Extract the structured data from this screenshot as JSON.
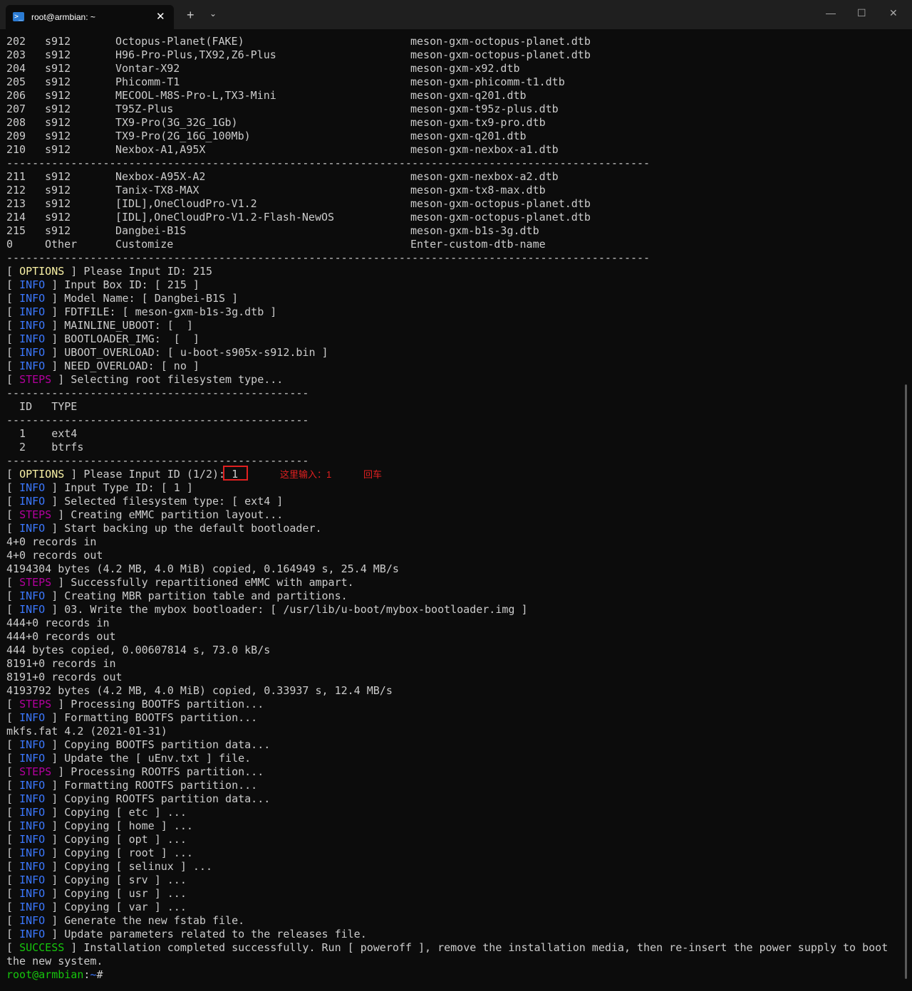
{
  "window": {
    "tab_title": "root@armbian: ~",
    "tab_icon": "powershell-icon",
    "tab_close": "✕",
    "new_tab": "+",
    "dropdown": "⌄",
    "minimize": "—",
    "maximize": "☐",
    "close": "✕"
  },
  "table_a": [
    [
      "202",
      "s912",
      "Octopus-Planet(FAKE)",
      "meson-gxm-octopus-planet.dtb"
    ],
    [
      "203",
      "s912",
      "H96-Pro-Plus,TX92,Z6-Plus",
      "meson-gxm-octopus-planet.dtb"
    ],
    [
      "204",
      "s912",
      "Vontar-X92",
      "meson-gxm-x92.dtb"
    ],
    [
      "205",
      "s912",
      "Phicomm-T1",
      "meson-gxm-phicomm-t1.dtb"
    ],
    [
      "206",
      "s912",
      "MECOOL-M8S-Pro-L,TX3-Mini",
      "meson-gxm-q201.dtb"
    ],
    [
      "207",
      "s912",
      "T95Z-Plus",
      "meson-gxm-t95z-plus.dtb"
    ],
    [
      "208",
      "s912",
      "TX9-Pro(3G_32G_1Gb)",
      "meson-gxm-tx9-pro.dtb"
    ],
    [
      "209",
      "s912",
      "TX9-Pro(2G_16G_100Mb)",
      "meson-gxm-q201.dtb"
    ],
    [
      "210",
      "s912",
      "Nexbox-A1,A95X",
      "meson-gxm-nexbox-a1.dtb"
    ]
  ],
  "table_b": [
    [
      "211",
      "s912",
      "Nexbox-A95X-A2",
      "meson-gxm-nexbox-a2.dtb"
    ],
    [
      "212",
      "s912",
      "Tanix-TX8-MAX",
      "meson-gxm-tx8-max.dtb"
    ],
    [
      "213",
      "s912",
      "[IDL],OneCloudPro-V1.2",
      "meson-gxm-octopus-planet.dtb"
    ],
    [
      "214",
      "s912",
      "[IDL],OneCloudPro-V1.2-Flash-NewOS",
      "meson-gxm-octopus-planet.dtb"
    ],
    [
      "215",
      "s912",
      "Dangbei-B1S",
      "meson-gxm-b1s-3g.dtb"
    ],
    [
      "0",
      "Other",
      "Customize",
      "Enter-custom-dtb-name"
    ]
  ],
  "long_separator": "----------------------------------------------------------------------------------------------------",
  "short_separator": "-----------------------------------------------",
  "log_a": [
    {
      "tag": "OPTIONS",
      "text": " ] Please Input ID: 215"
    },
    {
      "tag": "INFO",
      "text": " ] Input Box ID: [ 215 ]"
    },
    {
      "tag": "INFO",
      "text": " ] Model Name: [ Dangbei-B1S ]"
    },
    {
      "tag": "INFO",
      "text": " ] FDTFILE: [ meson-gxm-b1s-3g.dtb ]"
    },
    {
      "tag": "INFO",
      "text": " ] MAINLINE_UBOOT: [  ]"
    },
    {
      "tag": "INFO",
      "text": " ] BOOTLOADER_IMG:  [  ]"
    },
    {
      "tag": "INFO",
      "text": " ] UBOOT_OVERLOAD: [ u-boot-s905x-s912.bin ]"
    },
    {
      "tag": "INFO",
      "text": " ] NEED_OVERLOAD: [ no ]"
    },
    {
      "tag": "STEPS",
      "text": " ] Selecting root filesystem type..."
    }
  ],
  "fs_header": "  ID   TYPE",
  "fs_rows": [
    "  1    ext4",
    "  2    btrfs"
  ],
  "input_line": {
    "tag": "OPTIONS",
    "text": " ] Please Input ID (1/2): 1"
  },
  "log_b": [
    {
      "tag": "INFO",
      "text": " ] Input Type ID: [ 1 ]"
    },
    {
      "tag": "INFO",
      "text": " ] Selected filesystem type: [ ext4 ]"
    },
    {
      "tag": "STEPS",
      "text": " ] Creating eMMC partition layout..."
    },
    {
      "tag": "INFO",
      "text": " ] Start backing up the default bootloader."
    },
    {
      "tag": "",
      "text": "4+0 records in"
    },
    {
      "tag": "",
      "text": "4+0 records out"
    },
    {
      "tag": "",
      "text": "4194304 bytes (4.2 MB, 4.0 MiB) copied, 0.164949 s, 25.4 MB/s"
    },
    {
      "tag": "STEPS",
      "text": " ] Successfully repartitioned eMMC with ampart."
    },
    {
      "tag": "INFO",
      "text": " ] Creating MBR partition table and partitions."
    },
    {
      "tag": "INFO",
      "text": " ] 03. Write the mybox bootloader: [ /usr/lib/u-boot/mybox-bootloader.img ]"
    },
    {
      "tag": "",
      "text": "444+0 records in"
    },
    {
      "tag": "",
      "text": "444+0 records out"
    },
    {
      "tag": "",
      "text": "444 bytes copied, 0.00607814 s, 73.0 kB/s"
    },
    {
      "tag": "",
      "text": "8191+0 records in"
    },
    {
      "tag": "",
      "text": "8191+0 records out"
    },
    {
      "tag": "",
      "text": "4193792 bytes (4.2 MB, 4.0 MiB) copied, 0.33937 s, 12.4 MB/s"
    },
    {
      "tag": "STEPS",
      "text": " ] Processing BOOTFS partition..."
    },
    {
      "tag": "INFO",
      "text": " ] Formatting BOOTFS partition..."
    },
    {
      "tag": "",
      "text": "mkfs.fat 4.2 (2021-01-31)"
    },
    {
      "tag": "INFO",
      "text": " ] Copying BOOTFS partition data..."
    },
    {
      "tag": "INFO",
      "text": " ] Update the [ uEnv.txt ] file."
    },
    {
      "tag": "STEPS",
      "text": " ] Processing ROOTFS partition..."
    },
    {
      "tag": "INFO",
      "text": " ] Formatting ROOTFS partition..."
    },
    {
      "tag": "INFO",
      "text": " ] Copying ROOTFS partition data..."
    },
    {
      "tag": "INFO",
      "text": " ] Copying [ etc ] ..."
    },
    {
      "tag": "INFO",
      "text": " ] Copying [ home ] ..."
    },
    {
      "tag": "INFO",
      "text": " ] Copying [ opt ] ..."
    },
    {
      "tag": "INFO",
      "text": " ] Copying [ root ] ..."
    },
    {
      "tag": "INFO",
      "text": " ] Copying [ selinux ] ..."
    },
    {
      "tag": "INFO",
      "text": " ] Copying [ srv ] ..."
    },
    {
      "tag": "INFO",
      "text": " ] Copying [ usr ] ..."
    },
    {
      "tag": "INFO",
      "text": " ] Copying [ var ] ..."
    },
    {
      "tag": "INFO",
      "text": " ] Generate the new fstab file."
    },
    {
      "tag": "INFO",
      "text": " ] Update parameters related to the releases file."
    },
    {
      "tag": "SUCCESS",
      "text": " ] Installation completed successfully. Run [ poweroff ], remove the installation media, then re-insert the power supply to boot"
    },
    {
      "tag": "",
      "text": "the new system."
    }
  ],
  "prompt": {
    "user": "root@armbian",
    "sep": ":",
    "path": "~",
    "symbol": "#"
  },
  "annotation": {
    "text1": "这里输入：1",
    "text2": "回车"
  },
  "colors": {
    "background": "#0c0c0c",
    "text": "#cccccc",
    "options": "#f9f1a5",
    "info": "#3b78ff",
    "steps": "#b4009e",
    "success": "#16c60c",
    "annotation": "#e02020"
  }
}
